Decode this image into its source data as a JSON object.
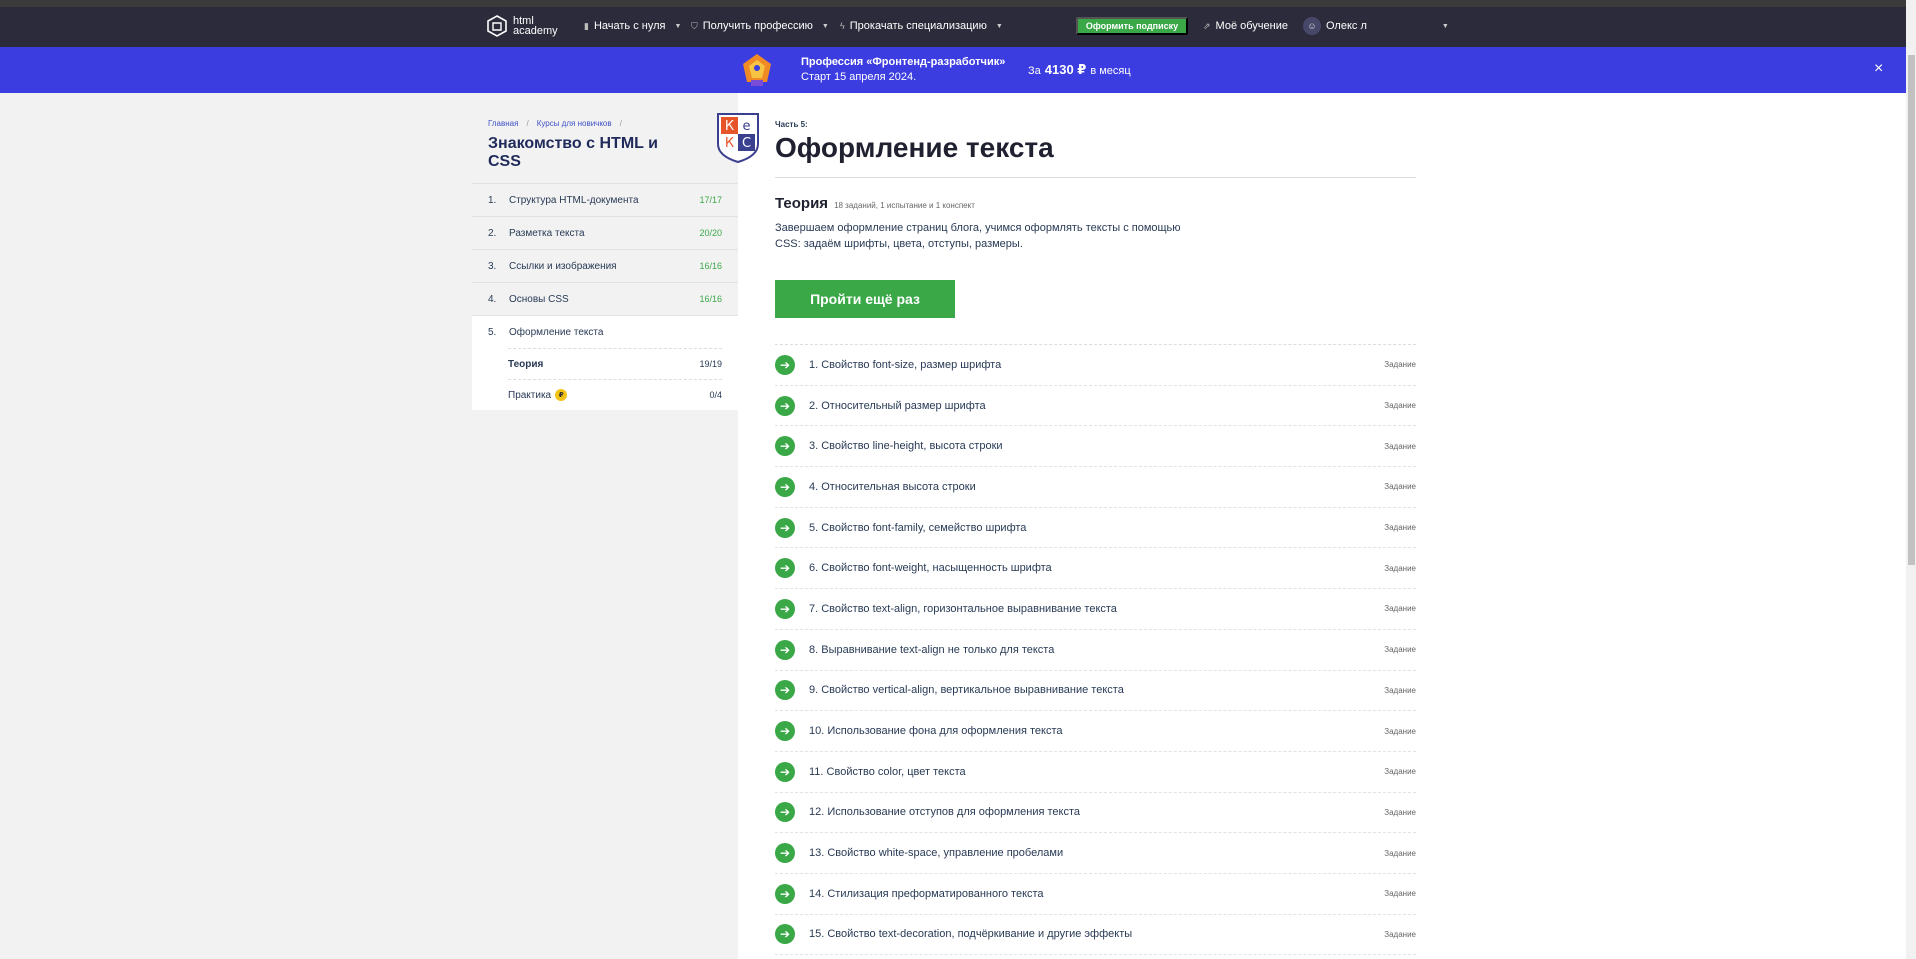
{
  "header": {
    "logo_line1": "html",
    "logo_line2": "academy",
    "nav": [
      {
        "label": "Начать с нуля",
        "icon": "bars-icon"
      },
      {
        "label": "Получить профессию",
        "icon": "shield-icon"
      },
      {
        "label": "Прокачать специализацию",
        "icon": "bolt-icon"
      }
    ],
    "subscribe_label": "Оформить подписку",
    "my_learning": "Моё обучение",
    "user_name": "Олекс л"
  },
  "promo": {
    "title": "Профессия «Фронтенд-разработчик»",
    "subtitle": "Старт 15 апреля 2024.",
    "price_prefix": "За",
    "price": "4130 ₽",
    "price_suffix": "в месяц",
    "close": "×"
  },
  "sidebar": {
    "breadcrumbs": [
      "Главная",
      "Курсы для новичков"
    ],
    "course_title": "Знакомство с HTML и CSS",
    "modules": [
      {
        "num": "1.",
        "name": "Структура HTML-документа",
        "count": "17/17"
      },
      {
        "num": "2.",
        "name": "Разметка текста",
        "count": "20/20"
      },
      {
        "num": "3.",
        "name": "Ссылки и изображения",
        "count": "16/16"
      },
      {
        "num": "4.",
        "name": "Основы CSS",
        "count": "16/16"
      },
      {
        "num": "5.",
        "name": "Оформление текста",
        "count": ""
      }
    ],
    "submodules": [
      {
        "name": "Теория",
        "count": "19/19"
      },
      {
        "name": "Практика",
        "count": "0/4",
        "badge": "₽"
      }
    ]
  },
  "main": {
    "shield_letters": [
      "К",
      "е",
      "К",
      "С"
    ],
    "part_label": "Часть 5:",
    "title": "Оформление текста",
    "theory_heading": "Теория",
    "theory_meta": "18 заданий, 1 испытание и 1 конспект",
    "description": "Завершаем оформление страниц блога, учимся оформлять тексты с помощью CSS: задаём шрифты, цвета, отступы, размеры.",
    "retry_label": "Пройти ещё раз",
    "lessons": [
      {
        "title": "1. Свойство font-size, размер шрифта",
        "type": "Задание"
      },
      {
        "title": "2. Относительный размер шрифта",
        "type": "Задание"
      },
      {
        "title": "3. Свойство line-height, высота строки",
        "type": "Задание"
      },
      {
        "title": "4. Относительная высота строки",
        "type": "Задание"
      },
      {
        "title": "5. Свойство font-family, семейство шрифта",
        "type": "Задание"
      },
      {
        "title": "6. Свойство font-weight, насыщенность шрифта",
        "type": "Задание"
      },
      {
        "title": "7. Свойство text-align, горизонтальное выравнивание текста",
        "type": "Задание"
      },
      {
        "title": "8. Выравнивание text-align не только для текста",
        "type": "Задание"
      },
      {
        "title": "9. Свойство vertical-align, вертикальное выравнивание текста",
        "type": "Задание"
      },
      {
        "title": "10. Использование фона для оформления текста",
        "type": "Задание"
      },
      {
        "title": "11. Свойство color, цвет текста",
        "type": "Задание"
      },
      {
        "title": "12. Использование отступов для оформления текста",
        "type": "Задание"
      },
      {
        "title": "13. Свойство white-space, управление пробелами",
        "type": "Задание"
      },
      {
        "title": "14. Стилизация преформатированного текста",
        "type": "Задание"
      },
      {
        "title": "15. Свойство text-decoration, подчёркивание и другие эффекты",
        "type": "Задание"
      }
    ]
  },
  "colors": {
    "header_bg": "#2b2b3b",
    "promo_bg": "#3b3de0",
    "accent_green": "#3ba848",
    "title_navy": "#1f2a5a"
  }
}
